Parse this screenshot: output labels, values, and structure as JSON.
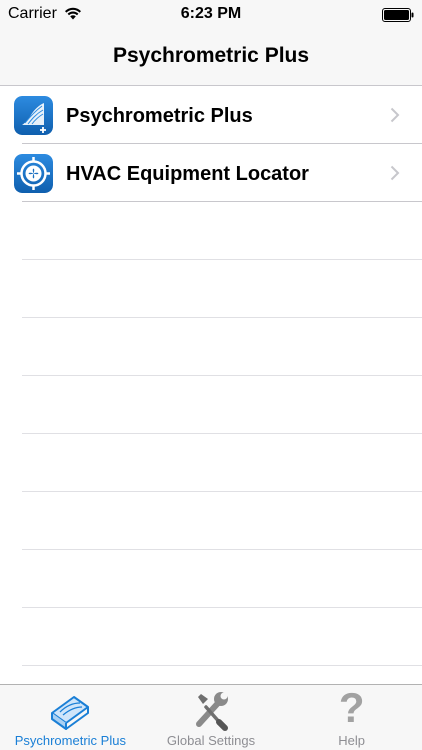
{
  "status_bar": {
    "carrier": "Carrier",
    "time": "6:23 PM",
    "wifi_icon": "wifi-icon",
    "battery_icon": "battery-icon"
  },
  "nav": {
    "title": "Psychrometric Plus"
  },
  "list": {
    "items": [
      {
        "label": "Psychrometric Plus",
        "icon": "psychrometric-chart-icon"
      },
      {
        "label": "HVAC Equipment Locator",
        "icon": "fan-locator-icon"
      }
    ],
    "empty_rows": 8
  },
  "tab_bar": {
    "tabs": [
      {
        "label": "Psychrometric Plus",
        "icon": "psychrometric-box-icon",
        "active": true
      },
      {
        "label": "Global Settings",
        "icon": "wrench-screwdriver-icon",
        "active": false
      },
      {
        "label": "Help",
        "icon": "question-mark-icon",
        "active": false
      }
    ]
  },
  "colors": {
    "accent": "#1a7fd6",
    "inactive": "#8e8e93",
    "separator": "#c8c7cc",
    "bar_background": "#f7f7f7"
  }
}
